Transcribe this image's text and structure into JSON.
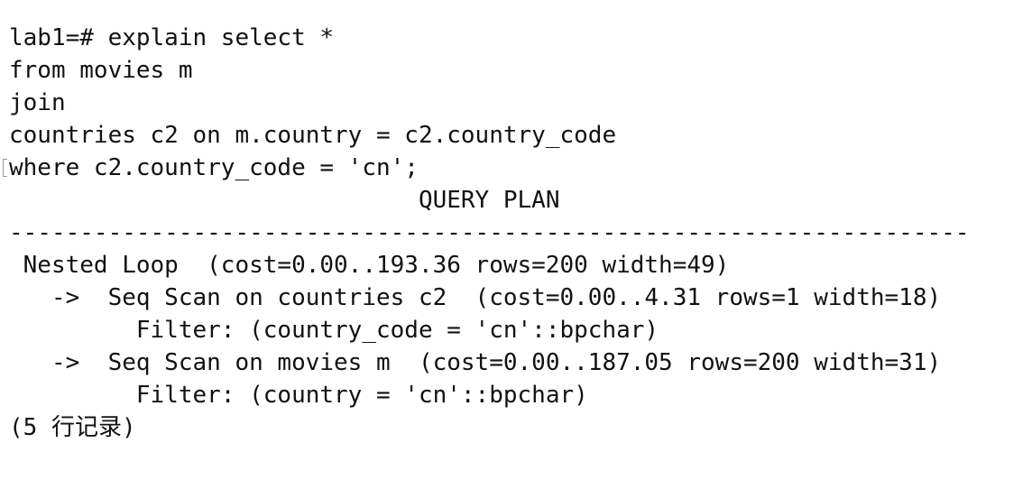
{
  "terminal": {
    "prompt": "lab1=#",
    "query_lines": [
      "lab1=# explain select *",
      "from movies m",
      "join",
      "countries c2 on m.country = c2.country_code",
      "where c2.country_code = 'cn';"
    ],
    "result": {
      "header": "                             QUERY PLAN",
      "separator": "--------------------------------------------------------------------",
      "plan_lines": [
        " Nested Loop  (cost=0.00..193.36 rows=200 width=49)",
        "   ->  Seq Scan on countries c2  (cost=0.00..4.31 rows=1 width=18)",
        "         Filter: (country_code = 'cn'::bpchar)",
        "   ->  Seq Scan on movies m  (cost=0.00..187.05 rows=200 width=31)",
        "         Filter: (country = 'cn'::bpchar)"
      ],
      "footer": "(5 行记录)"
    }
  }
}
